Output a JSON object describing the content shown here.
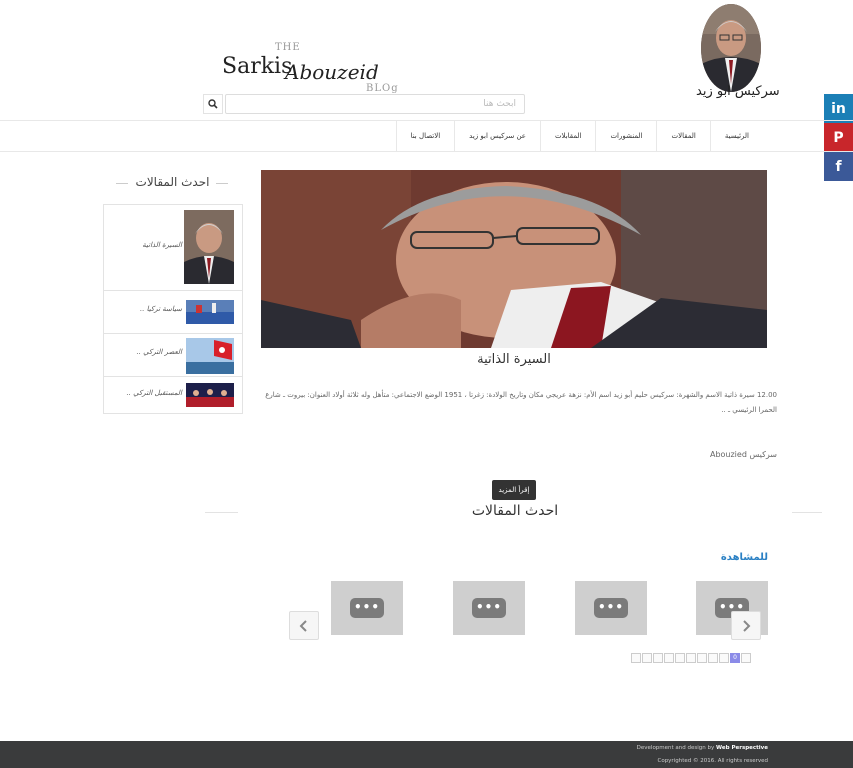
{
  "header": {
    "logo": {
      "the": "THE",
      "sarkis": "Sarkis",
      "abouzeid": "Abouzeid",
      "blog": "BLOg"
    },
    "avatar_name": "سركيس ابو زيد",
    "search": {
      "placeholder": "ابحث هنا",
      "icon": "search-icon"
    }
  },
  "social": [
    {
      "name": "linkedin",
      "label": "in",
      "color": "#1b7fb6"
    },
    {
      "name": "pinterest",
      "label": "P",
      "color": "#c8262b"
    },
    {
      "name": "facebook",
      "label": "f",
      "color": "#3b5998"
    }
  ],
  "nav": {
    "items": [
      "الرئيسية",
      "المقالات",
      "المنشورات",
      "المقابلات",
      "عن سركيس ابو زيد",
      "الاتصال بنا"
    ]
  },
  "sidebar": {
    "title": "احدث المقالات",
    "items": [
      {
        "label": "السيرة الذاتية"
      },
      {
        "label": "سياسة تركيا .."
      },
      {
        "label": "العصر التركي .."
      },
      {
        "label": "المستقبل التركي .."
      }
    ]
  },
  "article": {
    "title": "السيرة الذاتية",
    "excerpt": "12.00 سيرة ذاتية الاسم والشهرة: سركيس حليم أبو زيد اسم الأم: نزهة عريجي مكان وتاريخ الولادة: زغرتا ، 1951 الوضع الاجتماعي: متأهل وله ثلاثة أولاد العنوان: بيروت ـ شارع الحمرا الرئيسي ـ ..",
    "author": "Abouzied سركيس",
    "read_more": "إقرأ المزيد"
  },
  "latest": {
    "title": "احدث المقالات",
    "view_link": "للمشاهدة",
    "cards_count_visible": 4,
    "card_icon": "ellipsis-icon",
    "pager": {
      "active": "0"
    }
  },
  "footer": {
    "line1_prefix": "Development and design by",
    "line1_brand": "Web Perspective",
    "line2": "Copyrighted © 2016. All rights reserved"
  }
}
